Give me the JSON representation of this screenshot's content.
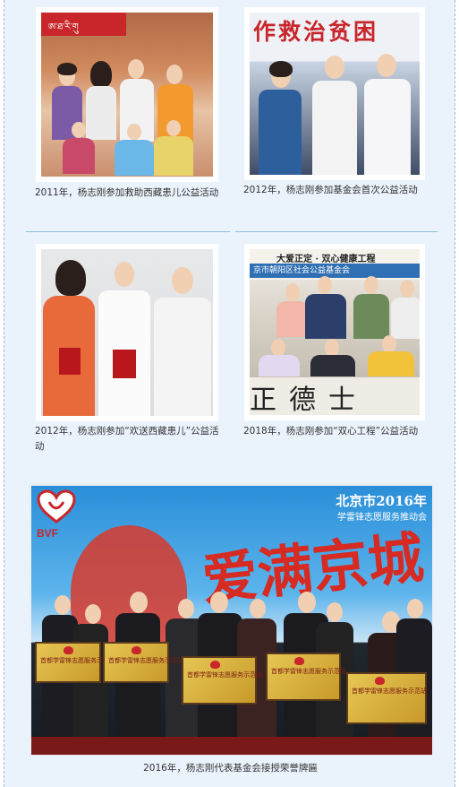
{
  "gallery": {
    "items": [
      {
        "caption": "2011年，杨志刚参加救助西藏患儿公益活动"
      },
      {
        "caption": "2012年，杨志刚参加基金会首次公益活动"
      },
      {
        "caption": "2012年，杨志刚参加“欢送西藏患儿”公益活动"
      },
      {
        "caption": "2018年，杨志刚参加“双心工程”公益活动"
      },
      {
        "caption": "2016年，杨志刚代表基金会接授荣誉牌匾"
      }
    ]
  },
  "photos": {
    "p1": {
      "banner_text": "ཨ་ཐ་རི་གུ"
    },
    "p2": {
      "backdrop_text": "作救治贫困"
    },
    "p4": {
      "top_text": "大爱正定 · 双心健康工程",
      "strip_text": "京市朝阳区社会公益基金会",
      "calligraphy": "正德士"
    },
    "p5": {
      "logo": "BVF",
      "headline": "北京市2016年",
      "subheadline": "学雷锋志愿服务推动会",
      "slogan": "爱满京城",
      "plaque_text": "首都学雷锋志愿服务示范站"
    }
  }
}
